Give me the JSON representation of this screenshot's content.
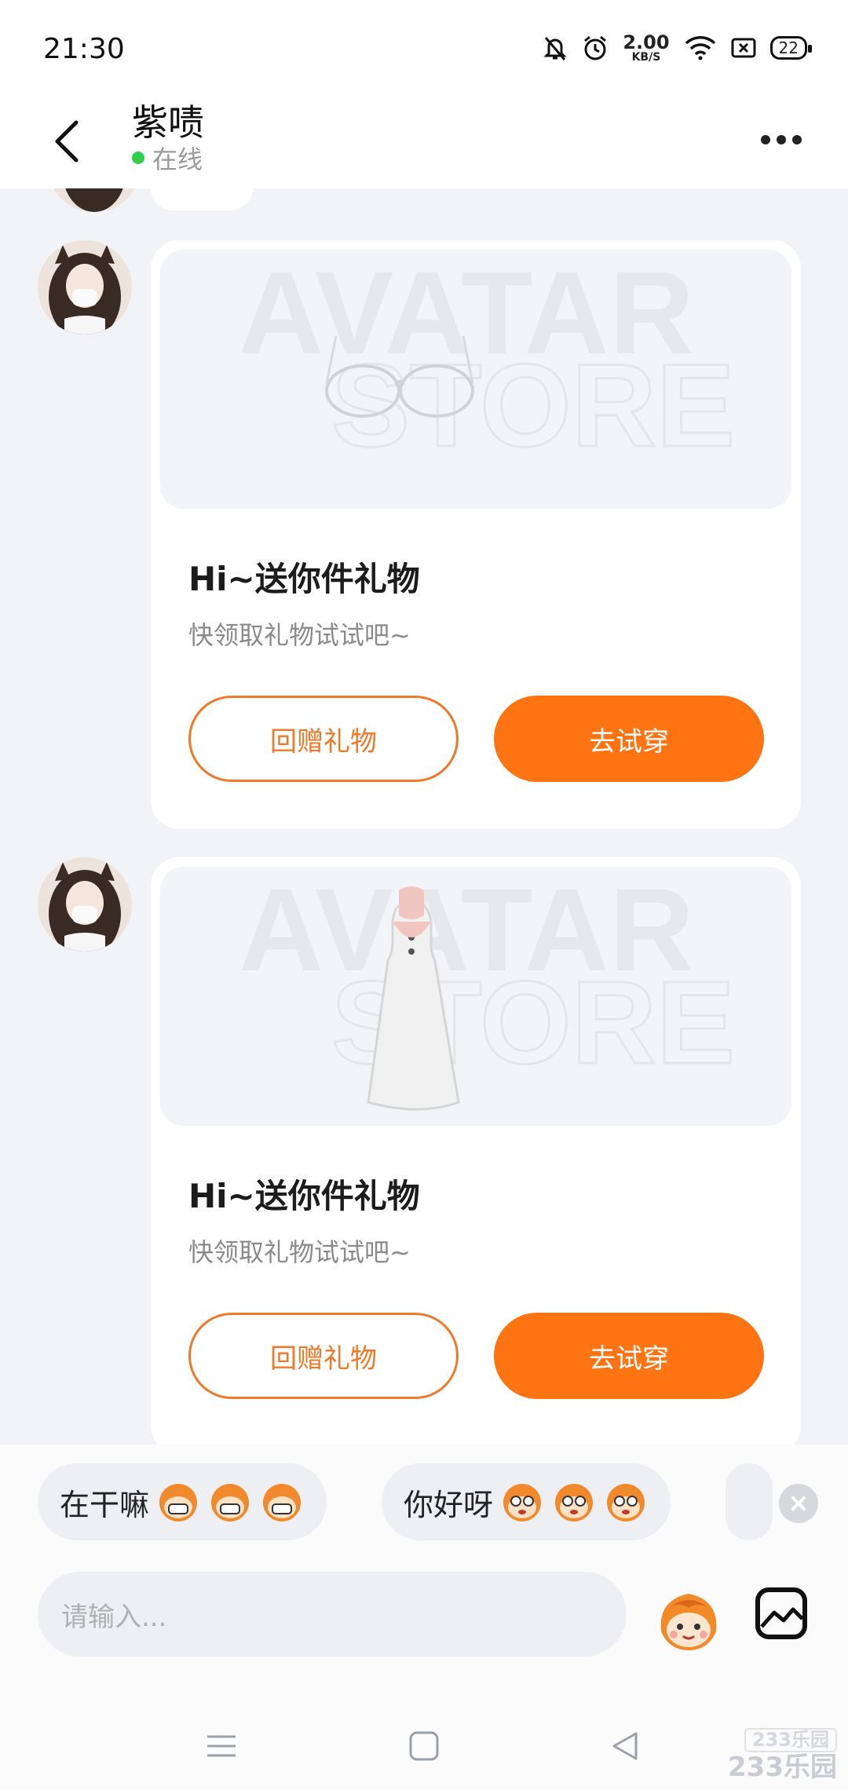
{
  "status_bar": {
    "time": "21:30",
    "net_speed_value": "2.00",
    "net_speed_unit": "KB/S",
    "battery": "22",
    "icons": [
      "mute-bell-icon",
      "alarm-icon",
      "wifi-icon",
      "sim-icon",
      "battery-icon"
    ]
  },
  "header": {
    "title": "紫啧",
    "status": "在线"
  },
  "messages": [
    {
      "image_watermark": [
        "AVATAR",
        "STORE"
      ],
      "item": "glasses",
      "title": "Hi~送你件礼物",
      "subtitle": "快领取礼物试试吧~",
      "return_gift_label": "回赠礼物",
      "try_on_label": "去试穿"
    },
    {
      "image_watermark": [
        "AVATAR",
        "STORE"
      ],
      "item": "white-dress",
      "title": "Hi~送你件礼物",
      "subtitle": "快领取礼物试试吧~",
      "return_gift_label": "回赠礼物",
      "try_on_label": "去试穿"
    }
  ],
  "quick_replies": [
    {
      "text": "在干嘛"
    },
    {
      "text": "你好呀"
    }
  ],
  "input": {
    "placeholder": "请输入..."
  },
  "watermark": {
    "badge": "233乐园",
    "text": "233乐园"
  },
  "colors": {
    "accent": "#ff7412",
    "online": "#2fcf4a",
    "background": "#f1f3f6"
  }
}
